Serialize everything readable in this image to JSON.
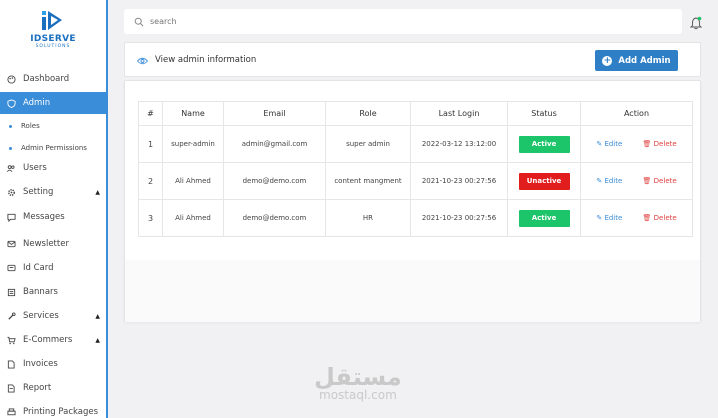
{
  "brand": {
    "name": "IDSERVE",
    "sub": "SOLUTIONS"
  },
  "sidebar": {
    "items": [
      {
        "label": "Dashboard",
        "icon": "palette-icon"
      },
      {
        "label": "Admin",
        "icon": "shield-icon"
      },
      {
        "label": "Users",
        "icon": "users-icon"
      },
      {
        "label": "Setting",
        "icon": "gear-icon"
      },
      {
        "label": "Messages",
        "icon": "chat-icon"
      },
      {
        "label": "Newsletter",
        "icon": "mail-icon"
      },
      {
        "label": "Id Card",
        "icon": "id-card-icon"
      },
      {
        "label": "Bannars",
        "icon": "banner-icon"
      },
      {
        "label": "Services",
        "icon": "tools-icon"
      },
      {
        "label": "E-Commers",
        "icon": "cart-icon"
      },
      {
        "label": "Invoices",
        "icon": "invoice-icon"
      },
      {
        "label": "Report",
        "icon": "report-icon"
      },
      {
        "label": "Printing Packages",
        "icon": "print-icon"
      }
    ],
    "subitems": [
      {
        "label": "Roles"
      },
      {
        "label": "Admin Permissions"
      }
    ]
  },
  "search": {
    "placeholder": "search"
  },
  "header": {
    "title": "View admin information",
    "add_label": "Add Admin"
  },
  "table": {
    "columns": [
      "#",
      "Name",
      "Email",
      "Role",
      "Last Login",
      "Status",
      "Action"
    ],
    "rows": [
      {
        "num": "1",
        "name": "super-admin",
        "email": "admin@gmail.com",
        "role": "super admin",
        "last_login": "2022-03-12 13:12:00",
        "status": "Active",
        "edit": "Edite",
        "delete": "Delete"
      },
      {
        "num": "2",
        "name": "Ali Ahmed",
        "email": "demo@demo.com",
        "role": "content mangment",
        "last_login": "2021-10-23 00:27:56",
        "status": "Unactive",
        "edit": "Edite",
        "delete": "Delete"
      },
      {
        "num": "3",
        "name": "Ali Ahmed",
        "email": "demo@demo.com",
        "role": "HR",
        "last_login": "2021-10-23 00:27:56",
        "status": "Active",
        "edit": "Edite",
        "delete": "Delete"
      }
    ]
  },
  "watermark": {
    "arabic": "مستقل",
    "latin": "mostaql.com"
  },
  "colors": {
    "accent": "#3a8dd8",
    "active": "#1cc46a",
    "inactive": "#e21d1d",
    "delete": "#e14141"
  }
}
